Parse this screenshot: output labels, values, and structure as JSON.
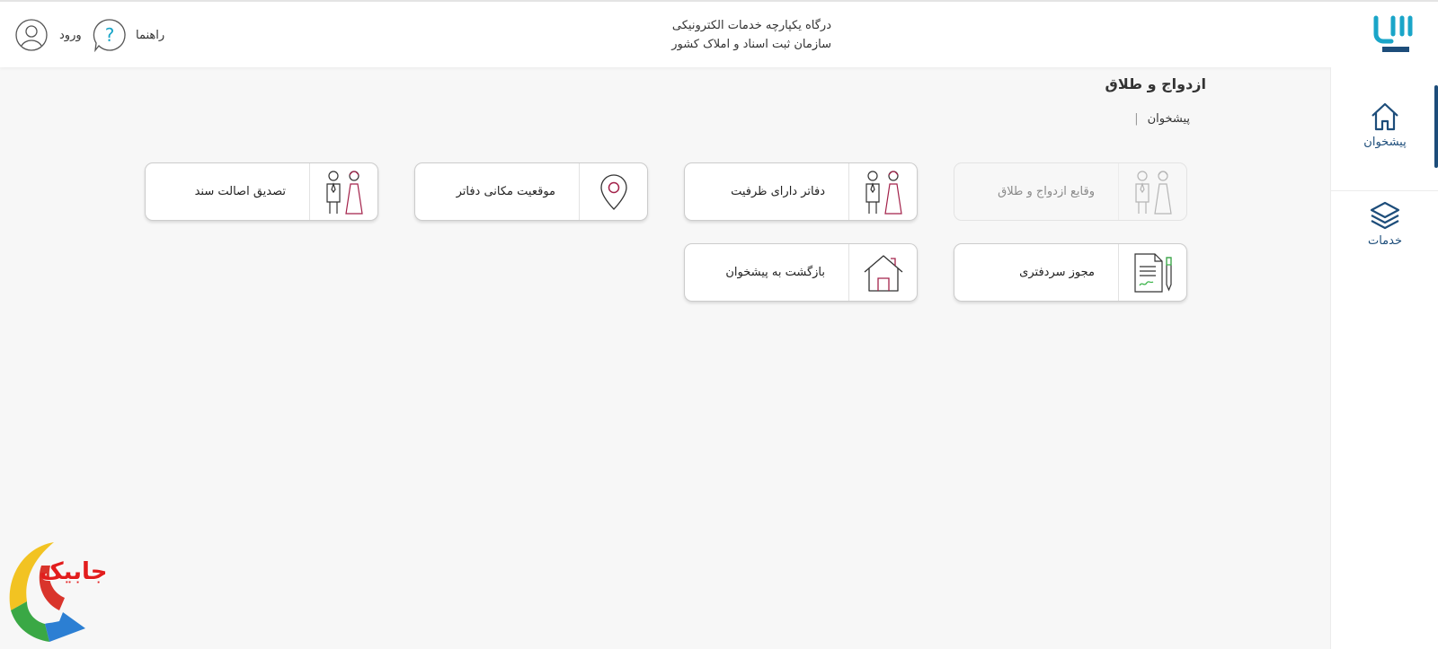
{
  "header": {
    "title_line1": "درگاه یکپارچه خدمات الکترونیکی",
    "title_line2": "سازمان ثبت اسناد و املاک کشور",
    "help_label": "راهنما",
    "login_label": "ورود",
    "logo_icon": "sabt-logo-icon"
  },
  "sidebar": {
    "items": [
      {
        "label": "پیشخوان",
        "icon": "home-icon"
      },
      {
        "label": "خدمات",
        "icon": "layers-icon"
      }
    ],
    "accent": "#1d4d7a"
  },
  "page": {
    "title": "ازدواج و طلاق",
    "breadcrumb": "پیشخوان"
  },
  "cards": [
    {
      "label": "وقایع ازدواج و طلاق",
      "icon": "bride-groom-icon",
      "disabled": true
    },
    {
      "label": "دفاتر دارای ظرفیت",
      "icon": "bride-groom-icon",
      "disabled": false
    },
    {
      "label": "موقعیت مکانی دفاتر",
      "icon": "location-pin-icon",
      "disabled": false
    },
    {
      "label": "تصدیق اصالت سند",
      "icon": "bride-groom-icon",
      "disabled": false
    },
    {
      "label": "مجوز سردفتری",
      "icon": "document-pen-icon",
      "disabled": false
    },
    {
      "label": "بازگشت به پیشخوان",
      "icon": "house-icon",
      "disabled": false
    }
  ],
  "watermark": {
    "text": "جابیک"
  },
  "colors": {
    "brand_teal": "#1aa5c8",
    "brand_navy": "#1d4d7a",
    "accent_crimson": "#a3224a"
  }
}
